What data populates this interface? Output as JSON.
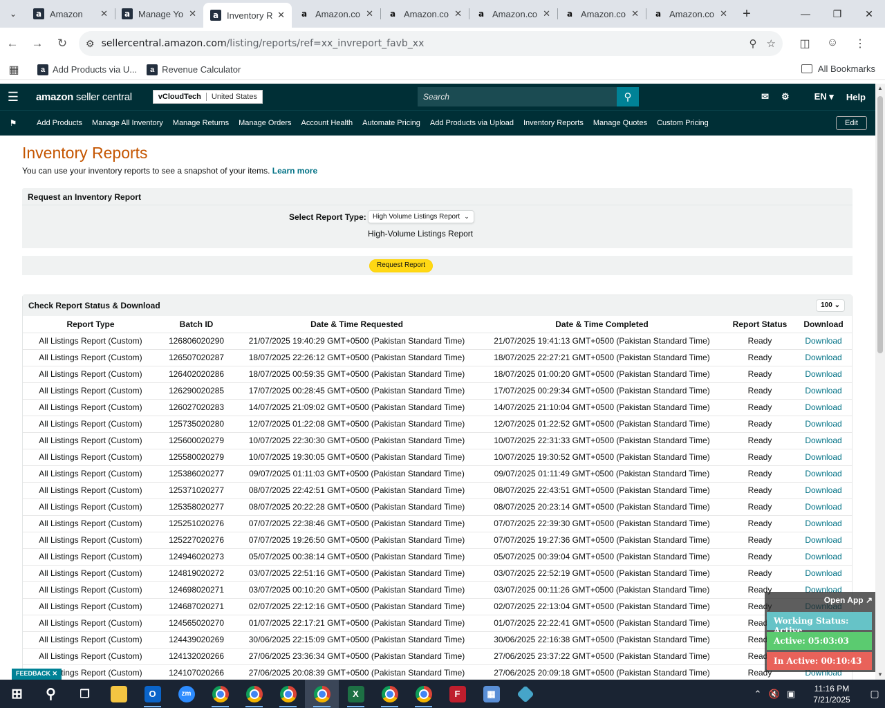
{
  "browser": {
    "tabs": [
      {
        "title": "Amazon",
        "icon": "amazon-dark"
      },
      {
        "title": "Manage Yo",
        "icon": "amazon-dark"
      },
      {
        "title": "Inventory R",
        "icon": "amazon-dark",
        "active": true
      },
      {
        "title": "Amazon.co",
        "icon": "amazon-light"
      },
      {
        "title": "Amazon.co",
        "icon": "amazon-light"
      },
      {
        "title": "Amazon.co",
        "icon": "amazon-light"
      },
      {
        "title": "Amazon.co",
        "icon": "amazon-light"
      },
      {
        "title": "Amazon.co",
        "icon": "amazon-light"
      }
    ],
    "url_host": "sellercentral.amazon.com",
    "url_path": "/listing/reports/ref=xx_invreport_favb_xx",
    "bookmarks": [
      {
        "label": "Add Products via U..."
      },
      {
        "label": "Revenue Calculator"
      }
    ],
    "all_bookmarks": "All Bookmarks"
  },
  "header": {
    "logo_main": "amazon",
    "logo_sub": " seller central",
    "store_name": "vCloudTech",
    "marketplace": "United States",
    "search_placeholder": "Search",
    "language": "EN",
    "help": "Help"
  },
  "nav": {
    "items": [
      "Add Products",
      "Manage All Inventory",
      "Manage Returns",
      "Manage Orders",
      "Account Health",
      "Automate Pricing",
      "Add Products via Upload",
      "Inventory Reports",
      "Manage Quotes",
      "Custom Pricing"
    ],
    "edit": "Edit"
  },
  "page": {
    "title": "Inventory Reports",
    "description": "You can use your inventory reports to see a snapshot of your items.",
    "learn_more": "Learn more",
    "request_heading": "Request an Inventory Report",
    "select_label": "Select Report Type:",
    "selected_type": "High Volume Listings Report",
    "selected_note": "High-Volume Listings Report",
    "request_button": "Request Report",
    "status_heading": "Check Report Status & Download",
    "page_size": "100"
  },
  "table": {
    "headers": [
      "Report Type",
      "Batch ID",
      "Date & Time Requested",
      "Date & Time Completed",
      "Report Status",
      "Download"
    ],
    "rows": [
      [
        "All Listings Report (Custom)",
        "126806020290",
        "21/07/2025 19:40:29 GMT+0500 (Pakistan Standard Time)",
        "21/07/2025 19:41:13 GMT+0500 (Pakistan Standard Time)",
        "Ready",
        "Download"
      ],
      [
        "All Listings Report (Custom)",
        "126507020287",
        "18/07/2025 22:26:12 GMT+0500 (Pakistan Standard Time)",
        "18/07/2025 22:27:21 GMT+0500 (Pakistan Standard Time)",
        "Ready",
        "Download"
      ],
      [
        "All Listings Report (Custom)",
        "126402020286",
        "18/07/2025 00:59:35 GMT+0500 (Pakistan Standard Time)",
        "18/07/2025 01:00:20 GMT+0500 (Pakistan Standard Time)",
        "Ready",
        "Download"
      ],
      [
        "All Listings Report (Custom)",
        "126290020285",
        "17/07/2025 00:28:45 GMT+0500 (Pakistan Standard Time)",
        "17/07/2025 00:29:34 GMT+0500 (Pakistan Standard Time)",
        "Ready",
        "Download"
      ],
      [
        "All Listings Report (Custom)",
        "126027020283",
        "14/07/2025 21:09:02 GMT+0500 (Pakistan Standard Time)",
        "14/07/2025 21:10:04 GMT+0500 (Pakistan Standard Time)",
        "Ready",
        "Download"
      ],
      [
        "All Listings Report (Custom)",
        "125735020280",
        "12/07/2025 01:22:08 GMT+0500 (Pakistan Standard Time)",
        "12/07/2025 01:22:52 GMT+0500 (Pakistan Standard Time)",
        "Ready",
        "Download"
      ],
      [
        "All Listings Report (Custom)",
        "125600020279",
        "10/07/2025 22:30:30 GMT+0500 (Pakistan Standard Time)",
        "10/07/2025 22:31:33 GMT+0500 (Pakistan Standard Time)",
        "Ready",
        "Download"
      ],
      [
        "All Listings Report (Custom)",
        "125580020279",
        "10/07/2025 19:30:05 GMT+0500 (Pakistan Standard Time)",
        "10/07/2025 19:30:52 GMT+0500 (Pakistan Standard Time)",
        "Ready",
        "Download"
      ],
      [
        "All Listings Report (Custom)",
        "125386020277",
        "09/07/2025 01:11:03 GMT+0500 (Pakistan Standard Time)",
        "09/07/2025 01:11:49 GMT+0500 (Pakistan Standard Time)",
        "Ready",
        "Download"
      ],
      [
        "All Listings Report (Custom)",
        "125371020277",
        "08/07/2025 22:42:51 GMT+0500 (Pakistan Standard Time)",
        "08/07/2025 22:43:51 GMT+0500 (Pakistan Standard Time)",
        "Ready",
        "Download"
      ],
      [
        "All Listings Report (Custom)",
        "125358020277",
        "08/07/2025 20:22:28 GMT+0500 (Pakistan Standard Time)",
        "08/07/2025 20:23:14 GMT+0500 (Pakistan Standard Time)",
        "Ready",
        "Download"
      ],
      [
        "All Listings Report (Custom)",
        "125251020276",
        "07/07/2025 22:38:46 GMT+0500 (Pakistan Standard Time)",
        "07/07/2025 22:39:30 GMT+0500 (Pakistan Standard Time)",
        "Ready",
        "Download"
      ],
      [
        "All Listings Report (Custom)",
        "125227020276",
        "07/07/2025 19:26:50 GMT+0500 (Pakistan Standard Time)",
        "07/07/2025 19:27:36 GMT+0500 (Pakistan Standard Time)",
        "Ready",
        "Download"
      ],
      [
        "All Listings Report (Custom)",
        "124946020273",
        "05/07/2025 00:38:14 GMT+0500 (Pakistan Standard Time)",
        "05/07/2025 00:39:04 GMT+0500 (Pakistan Standard Time)",
        "Ready",
        "Download"
      ],
      [
        "All Listings Report (Custom)",
        "124819020272",
        "03/07/2025 22:51:16 GMT+0500 (Pakistan Standard Time)",
        "03/07/2025 22:52:19 GMT+0500 (Pakistan Standard Time)",
        "Ready",
        "Download"
      ],
      [
        "All Listings Report (Custom)",
        "124698020271",
        "03/07/2025 00:10:20 GMT+0500 (Pakistan Standard Time)",
        "03/07/2025 00:11:26 GMT+0500 (Pakistan Standard Time)",
        "Ready",
        "Download"
      ],
      [
        "All Listings Report (Custom)",
        "124687020271",
        "02/07/2025 22:12:16 GMT+0500 (Pakistan Standard Time)",
        "02/07/2025 22:13:04 GMT+0500 (Pakistan Standard Time)",
        "Ready",
        "Download"
      ],
      [
        "All Listings Report (Custom)",
        "124565020270",
        "01/07/2025 22:17:21 GMT+0500 (Pakistan Standard Time)",
        "01/07/2025 22:22:41 GMT+0500 (Pakistan Standard Time)",
        "Ready",
        "Download"
      ],
      [
        "All Listings Report (Custom)",
        "124439020269",
        "30/06/2025 22:15:09 GMT+0500 (Pakistan Standard Time)",
        "30/06/2025 22:16:38 GMT+0500 (Pakistan Standard Time)",
        "Ready",
        "Download"
      ],
      [
        "All Listings Report (Custom)",
        "124132020266",
        "27/06/2025 23:36:34 GMT+0500 (Pakistan Standard Time)",
        "27/06/2025 23:37:22 GMT+0500 (Pakistan Standard Time)",
        "Ready",
        "Download"
      ],
      [
        "All Listings Report (Custom)",
        "124107020266",
        "27/06/2025 20:08:39 GMT+0500 (Pakistan Standard Time)",
        "27/06/2025 20:09:18 GMT+0500 (Pakistan Standard Time)",
        "Ready",
        "Download"
      ]
    ]
  },
  "feedback": "FEEDBACK",
  "widget": {
    "open_app": "Open App",
    "working_status": "Working Status: Active",
    "active": "Active: 05:03:03",
    "inactive": "In Active: 00:10:43"
  },
  "taskbar": {
    "time": "11:16 PM",
    "date": "7/21/2025"
  },
  "colors": {
    "header_bg": "#002f36",
    "title": "#c45500",
    "link": "#007185",
    "button": "#ffd814"
  }
}
